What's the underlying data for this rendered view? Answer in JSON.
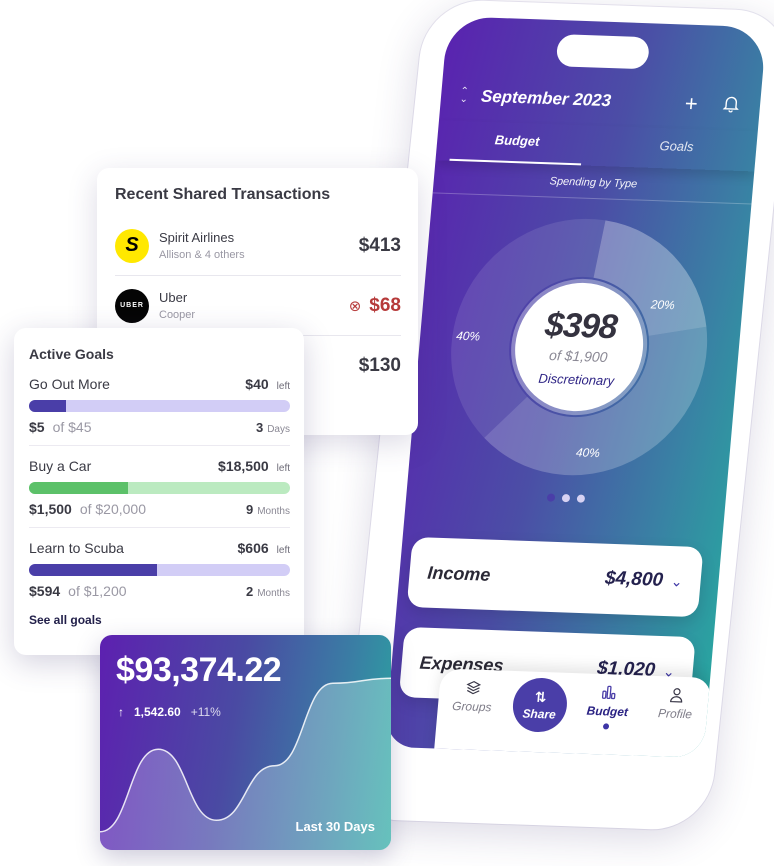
{
  "phone": {
    "header": {
      "month": "September 2023",
      "month_switch_icon": "up-down-chevron-icon",
      "add_icon": "plus-icon",
      "notifications_icon": "bell-icon"
    },
    "tabs": [
      {
        "label": "Budget",
        "active": true
      },
      {
        "label": "Goals",
        "active": false
      }
    ],
    "section_label": "Spending by Type",
    "donut": {
      "amount": "$398",
      "of_total": "of $1,900",
      "category": "Discretionary",
      "segments": [
        {
          "label": "20%",
          "value": 20
        },
        {
          "label": "40%",
          "value": 40
        },
        {
          "label": "40%",
          "value": 40
        }
      ],
      "page_count": 3,
      "active_page": 0
    },
    "summary": [
      {
        "label": "Income",
        "amount": "$4,800"
      },
      {
        "label": "Expenses",
        "amount": "$1,020"
      }
    ],
    "bottom_nav": [
      {
        "label": "Groups",
        "icon": "layers-icon",
        "active": false
      },
      {
        "label": "Share",
        "icon": "transfer-arrows-icon",
        "active": false,
        "primary": true
      },
      {
        "label": "Budget",
        "icon": "bar-chart-icon",
        "active": true
      },
      {
        "label": "Profile",
        "icon": "person-icon",
        "active": false
      }
    ]
  },
  "transactions": {
    "title": "Recent Shared Transactions",
    "items": [
      {
        "merchant": "Spirit Airlines",
        "logo_text": "S",
        "sub": "Allison & 4 others",
        "amount": "$413",
        "declined": false
      },
      {
        "merchant": "Uber",
        "logo_text": "UBER",
        "sub": "Cooper",
        "amount": "$68",
        "declined": true
      },
      {
        "merchant": "",
        "logo_text": "",
        "sub": "",
        "amount": "$130",
        "declined": false
      }
    ]
  },
  "goals": {
    "title": "Active Goals",
    "items": [
      {
        "name": "Go Out More",
        "left": "$40",
        "left_label": "left",
        "saved": "$5",
        "of": "of $45",
        "time_num": "3",
        "time_unit": "Days",
        "progress": 0.14,
        "color": "#4a3ea8",
        "track": "#d2cdf6"
      },
      {
        "name": "Buy a Car",
        "left": "$18,500",
        "left_label": "left",
        "saved": "$1,500",
        "of": "of $20,000",
        "time_num": "9",
        "time_unit": "Months",
        "progress": 0.38,
        "color": "#5cc169",
        "track": "#bbeac0"
      },
      {
        "name": "Learn to Scuba",
        "left": "$606",
        "left_label": "left",
        "saved": "$594",
        "of": "of $1,200",
        "time_num": "2",
        "time_unit": "Months",
        "progress": 0.49,
        "color": "#4a3ea8",
        "track": "#d2cdf6"
      }
    ],
    "see_all": "See all goals"
  },
  "balance": {
    "amount": "$93,374.22",
    "change_icon": "arrow-up-icon",
    "change": "1,542.60",
    "change_pct": "+11%",
    "range": "Last 30 Days",
    "trend": [
      0.05,
      0.55,
      0.12,
      0.45,
      0.95,
      0.98
    ]
  },
  "colors": {
    "accent": "#4a3ea8",
    "declined": "#b63a3a",
    "gradient_start": "#5a22b0",
    "gradient_end": "#27a9a0"
  }
}
